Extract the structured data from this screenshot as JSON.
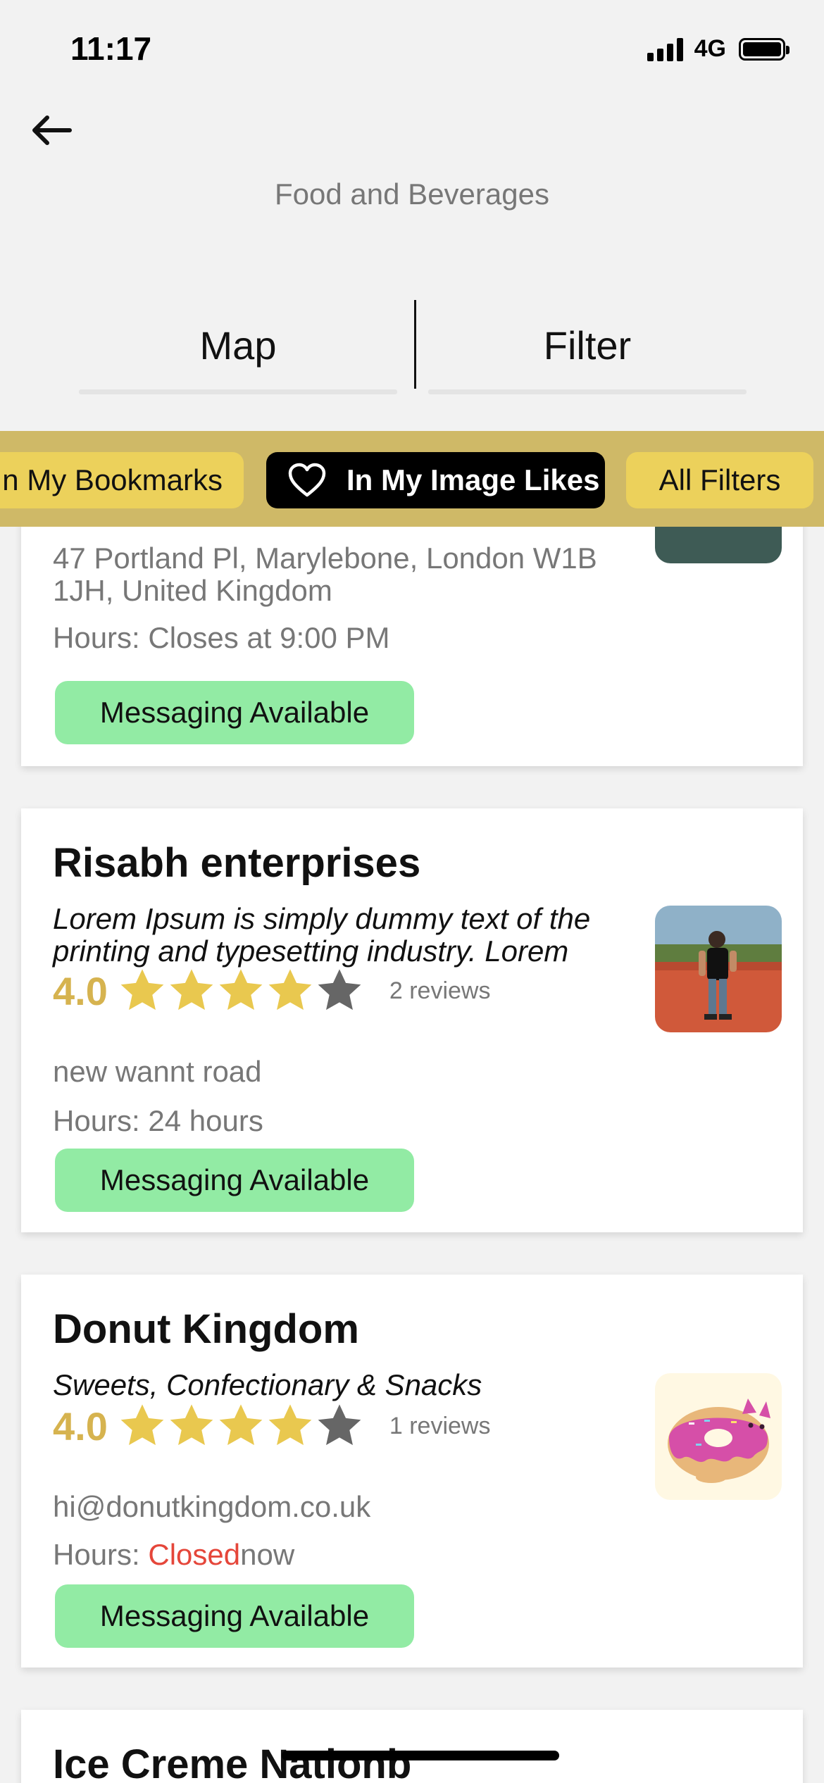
{
  "status": {
    "time": "11:17",
    "network": "4G"
  },
  "header": {
    "title": "Food and Beverages"
  },
  "tabs": {
    "map": "Map",
    "filter": "Filter"
  },
  "chips": {
    "bookmarks": "In My Bookmarks",
    "likes": "In My Image Likes",
    "all_filters": "All Filters"
  },
  "listings": [
    {
      "address": "47 Portland Pl, Marylebone, London W1B 1JH, United Kingdom",
      "hours_label": "Hours:",
      "hours": "Closes at 9:00 PM",
      "messaging": "Messaging Available"
    },
    {
      "name": "Risabh enterprises",
      "description": "Lorem Ipsum is simply dummy text of the printing and typesetting industry. Lorem",
      "rating": "4.0",
      "rating_value": 4,
      "reviews": "2 reviews",
      "address": "new wannt road",
      "hours_label": "Hours:",
      "hours": "24 hours",
      "messaging": "Messaging Available"
    },
    {
      "name": "Donut Kingdom",
      "description": "Sweets, Confectionary & Snacks",
      "rating": "4.0",
      "rating_value": 4,
      "reviews": "1 reviews",
      "address": "hi@donutkingdom.co.uk",
      "hours_label": "Hours:",
      "hours_status": "Closed",
      "hours_suffix": "now",
      "messaging": "Messaging Available"
    },
    {
      "name": "Ice Creme Nationb"
    }
  ],
  "colors": {
    "accent_gold": "#d6b34f",
    "chip_bar": "#cfb967",
    "chip": "#ecd15b",
    "messaging_green": "#92eba4",
    "closed_red": "#e5463a"
  }
}
